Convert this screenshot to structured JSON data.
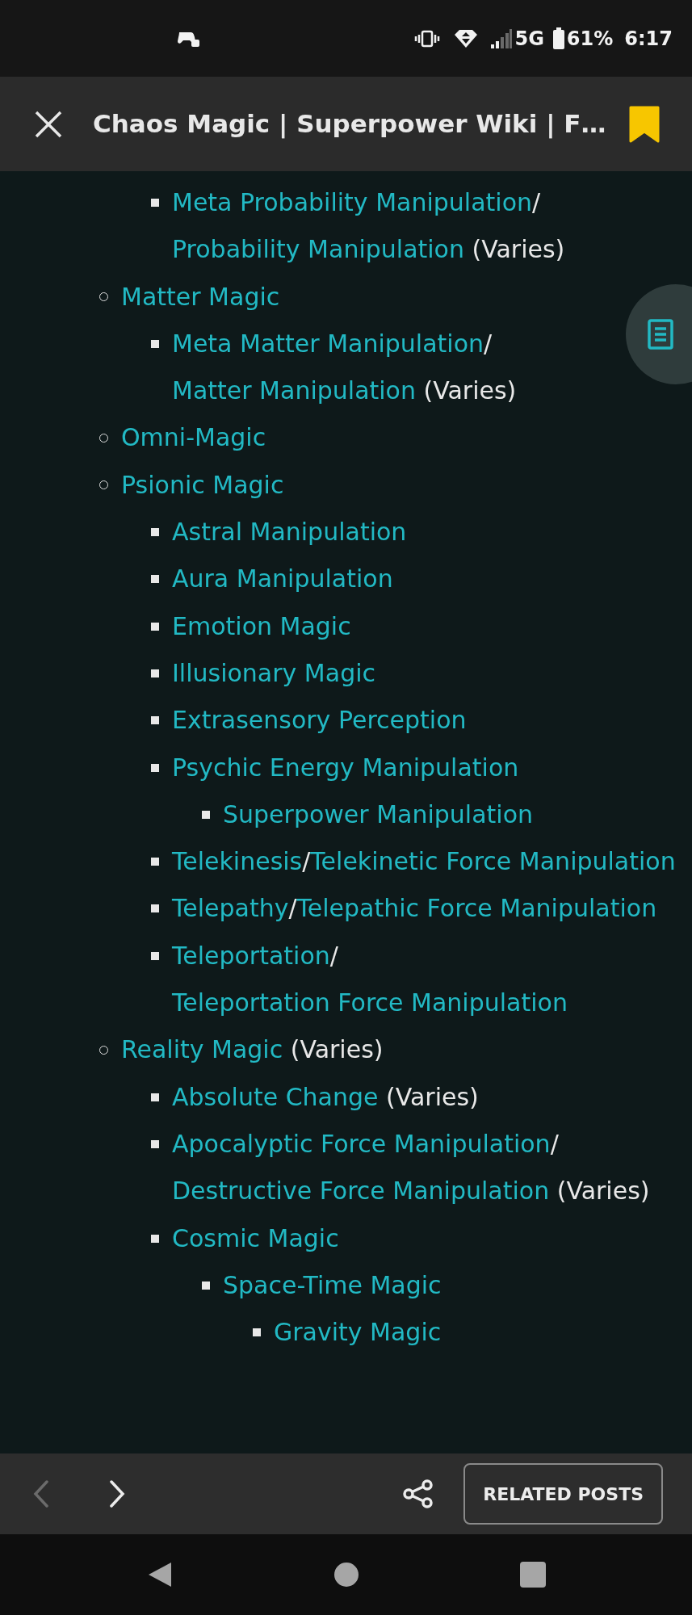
{
  "status_bar": {
    "network": "5G",
    "battery": "61%",
    "time": "6:17"
  },
  "top_bar": {
    "title": "Chaos Magic | Superpower Wiki | F…",
    "bookmarked": true
  },
  "list": [
    {
      "children": [
        {
          "parts": [
            {
              "kind": "link",
              "text": "Meta Probability Manipulation"
            },
            {
              "kind": "slash",
              "text": "/"
            },
            {
              "kind": "link",
              "text": "Probability Manipulation"
            },
            {
              "kind": "note",
              "text": "(Varies)"
            }
          ]
        }
      ]
    },
    {
      "parts": [
        {
          "kind": "link",
          "text": "Matter Magic"
        }
      ],
      "children": [
        {
          "parts": [
            {
              "kind": "link",
              "text": "Meta Matter Manipulation"
            },
            {
              "kind": "slash",
              "text": "/"
            },
            {
              "kind": "link",
              "text": "Matter Manipulation"
            },
            {
              "kind": "note",
              "text": "(Varies)"
            }
          ]
        }
      ]
    },
    {
      "parts": [
        {
          "kind": "link",
          "text": "Omni-Magic"
        }
      ]
    },
    {
      "parts": [
        {
          "kind": "link",
          "text": "Psionic Magic"
        }
      ],
      "children": [
        {
          "parts": [
            {
              "kind": "link",
              "text": "Astral Manipulation"
            }
          ]
        },
        {
          "parts": [
            {
              "kind": "link",
              "text": "Aura Manipulation"
            }
          ]
        },
        {
          "parts": [
            {
              "kind": "link",
              "text": "Emotion Magic"
            }
          ]
        },
        {
          "parts": [
            {
              "kind": "link",
              "text": "Illusionary Magic"
            }
          ]
        },
        {
          "parts": [
            {
              "kind": "link",
              "text": "Extrasensory Perception"
            }
          ]
        },
        {
          "parts": [
            {
              "kind": "link",
              "text": "Psychic Energy Manipulation"
            }
          ],
          "children": [
            {
              "parts": [
                {
                  "kind": "link",
                  "text": "Superpower Manipulation"
                }
              ]
            }
          ]
        },
        {
          "parts": [
            {
              "kind": "link",
              "text": "Telekinesis"
            },
            {
              "kind": "slash",
              "text": "/"
            },
            {
              "kind": "link",
              "text": "Telekinetic Force Manipulation"
            }
          ]
        },
        {
          "parts": [
            {
              "kind": "link",
              "text": "Telepathy"
            },
            {
              "kind": "slash",
              "text": "/"
            },
            {
              "kind": "link",
              "text": "Telepathic Force Manipulation"
            }
          ]
        },
        {
          "parts": [
            {
              "kind": "link",
              "text": "Teleportation"
            },
            {
              "kind": "slash",
              "text": "/"
            },
            {
              "kind": "link",
              "text": "Teleportation Force Manipulation"
            }
          ]
        }
      ]
    },
    {
      "parts": [
        {
          "kind": "link",
          "text": "Reality Magic"
        },
        {
          "kind": "note",
          "text": "(Varies)"
        }
      ],
      "children": [
        {
          "parts": [
            {
              "kind": "link",
              "text": "Absolute Change"
            },
            {
              "kind": "note",
              "text": "(Varies)"
            }
          ]
        },
        {
          "parts": [
            {
              "kind": "link",
              "text": "Apocalyptic Force Manipulation"
            },
            {
              "kind": "slash",
              "text": "/"
            },
            {
              "kind": "link",
              "text": "Destructive Force Manipulation"
            },
            {
              "kind": "note",
              "text": "(Varies)"
            }
          ]
        },
        {
          "parts": [
            {
              "kind": "link",
              "text": "Cosmic Magic"
            }
          ],
          "children": [
            {
              "parts": [
                {
                  "kind": "link",
                  "text": "Space-Time Magic"
                }
              ],
              "children": [
                {
                  "parts": [
                    {
                      "kind": "link",
                      "text": "Gravity Magic"
                    }
                  ]
                }
              ]
            }
          ]
        }
      ]
    }
  ],
  "bottom_bar": {
    "back_disabled": true,
    "forward_disabled": false,
    "button": "RELATED POSTS"
  }
}
